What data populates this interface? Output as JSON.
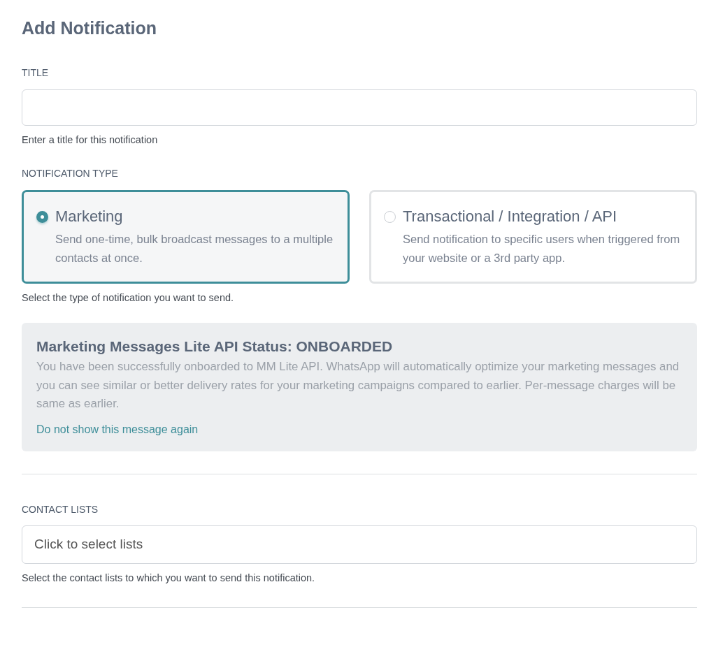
{
  "page_title": "Add Notification",
  "title_field": {
    "label": "TITLE",
    "help": "Enter a title for this notification"
  },
  "notification_type": {
    "label": "NOTIFICATION TYPE",
    "help": "Select the type of notification you want to send.",
    "options": [
      {
        "title": "Marketing",
        "description": "Send one-time, bulk broadcast messages to a multiple contacts at once.",
        "selected": true
      },
      {
        "title": "Transactional / Integration / API",
        "description": "Send notification to specific users when triggered from your website or a 3rd party app.",
        "selected": false
      }
    ]
  },
  "notice": {
    "title": "Marketing Messages Lite API Status: ONBOARDED",
    "body": "You have been successfully onboarded to MM Lite API. WhatsApp will automatically optimize your marketing messages and you can see similar or better delivery rates for your marketing campaigns compared to earlier. Per-message charges will be same as earlier.",
    "link": "Do not show this message again"
  },
  "contact_lists": {
    "label": "CONTACT LISTS",
    "placeholder": "Click to select lists",
    "help": "Select the contact lists to which you want to send this notification."
  }
}
